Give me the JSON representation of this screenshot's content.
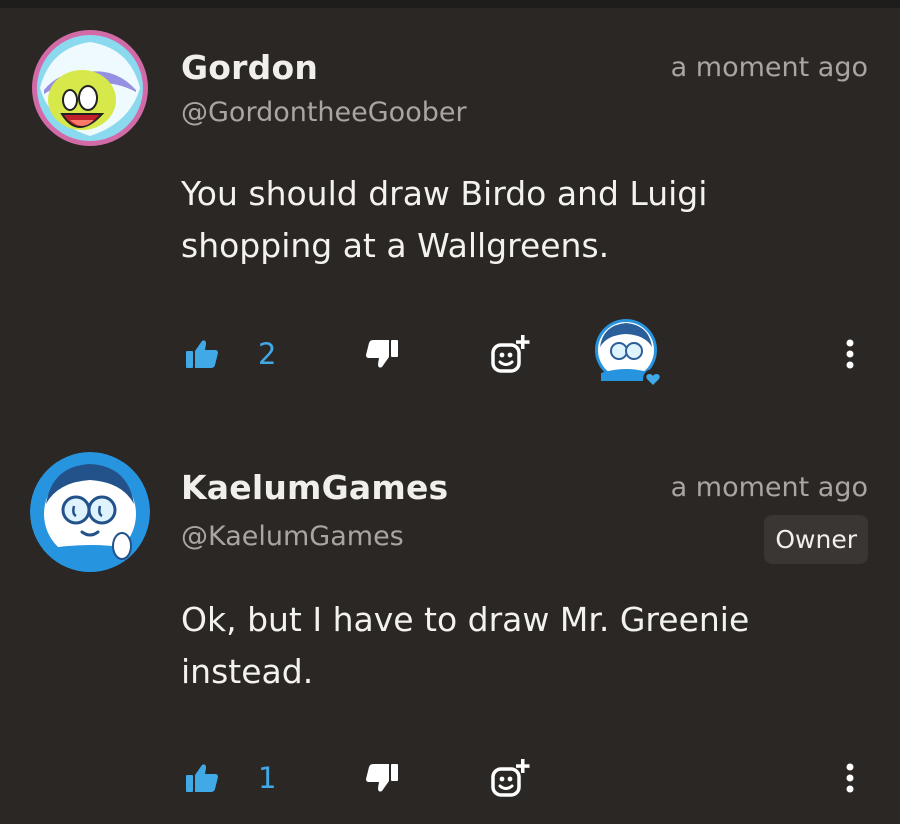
{
  "comments": [
    {
      "author": "Gordon",
      "handle": "@GordontheeGoober",
      "time": "a moment ago",
      "text": "You should draw Birdo and Luigi shopping at a Wallgreens.",
      "likes": "2",
      "avatar_icon": "cartoon-avatar-gordon",
      "liked_by_creator": true
    },
    {
      "author": "KaelumGames",
      "handle": "@KaelumGames",
      "time": "a moment ago",
      "badge": "Owner",
      "text": "Ok, but I have to draw Mr. Greenie instead.",
      "likes": "1",
      "avatar_icon": "cartoon-avatar-kaelum"
    }
  ],
  "colors": {
    "background": "#2a2725",
    "accent_blue": "#41a9e6",
    "text_primary": "#f1efec",
    "text_secondary": "#a9a5a0"
  }
}
